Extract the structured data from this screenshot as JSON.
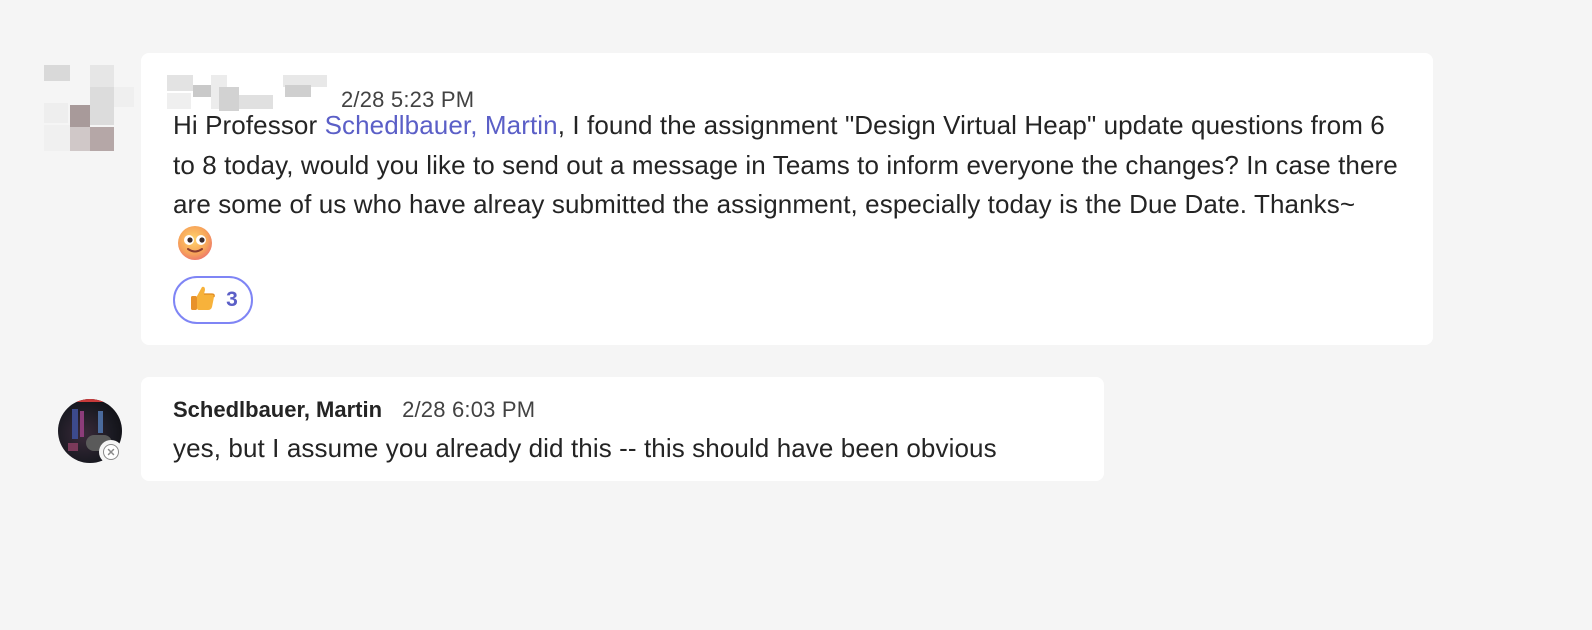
{
  "messages": [
    {
      "author_redacted": true,
      "timestamp": "2/28 5:23 PM",
      "text_before_mention": "Hi Professor ",
      "mention": "Schedlbauer, Martin",
      "text_after_mention": ", I found the assignment \"Design Virtual Heap\" update questions from 6 to 8 today, would you like to send out a message in Teams to inform everyone the changes? In case there are some of us who have alreay submitted the assignment, especially today is the Due Date. Thanks~",
      "trailing_emoji": "slightly-smiling-face-emoji",
      "reactions": [
        {
          "emoji": "thumbs-up-icon",
          "count": "3"
        }
      ]
    },
    {
      "author": "Schedlbauer, Martin",
      "timestamp": "2/28 6:03 PM",
      "text": "yes, but I assume you already did this -- this should have been obvious",
      "presence": "offline"
    }
  ],
  "colors": {
    "background": "#f5f5f5",
    "bubble": "#ffffff",
    "mention": "#5b5fc7",
    "reaction_border": "#7f85f5"
  }
}
